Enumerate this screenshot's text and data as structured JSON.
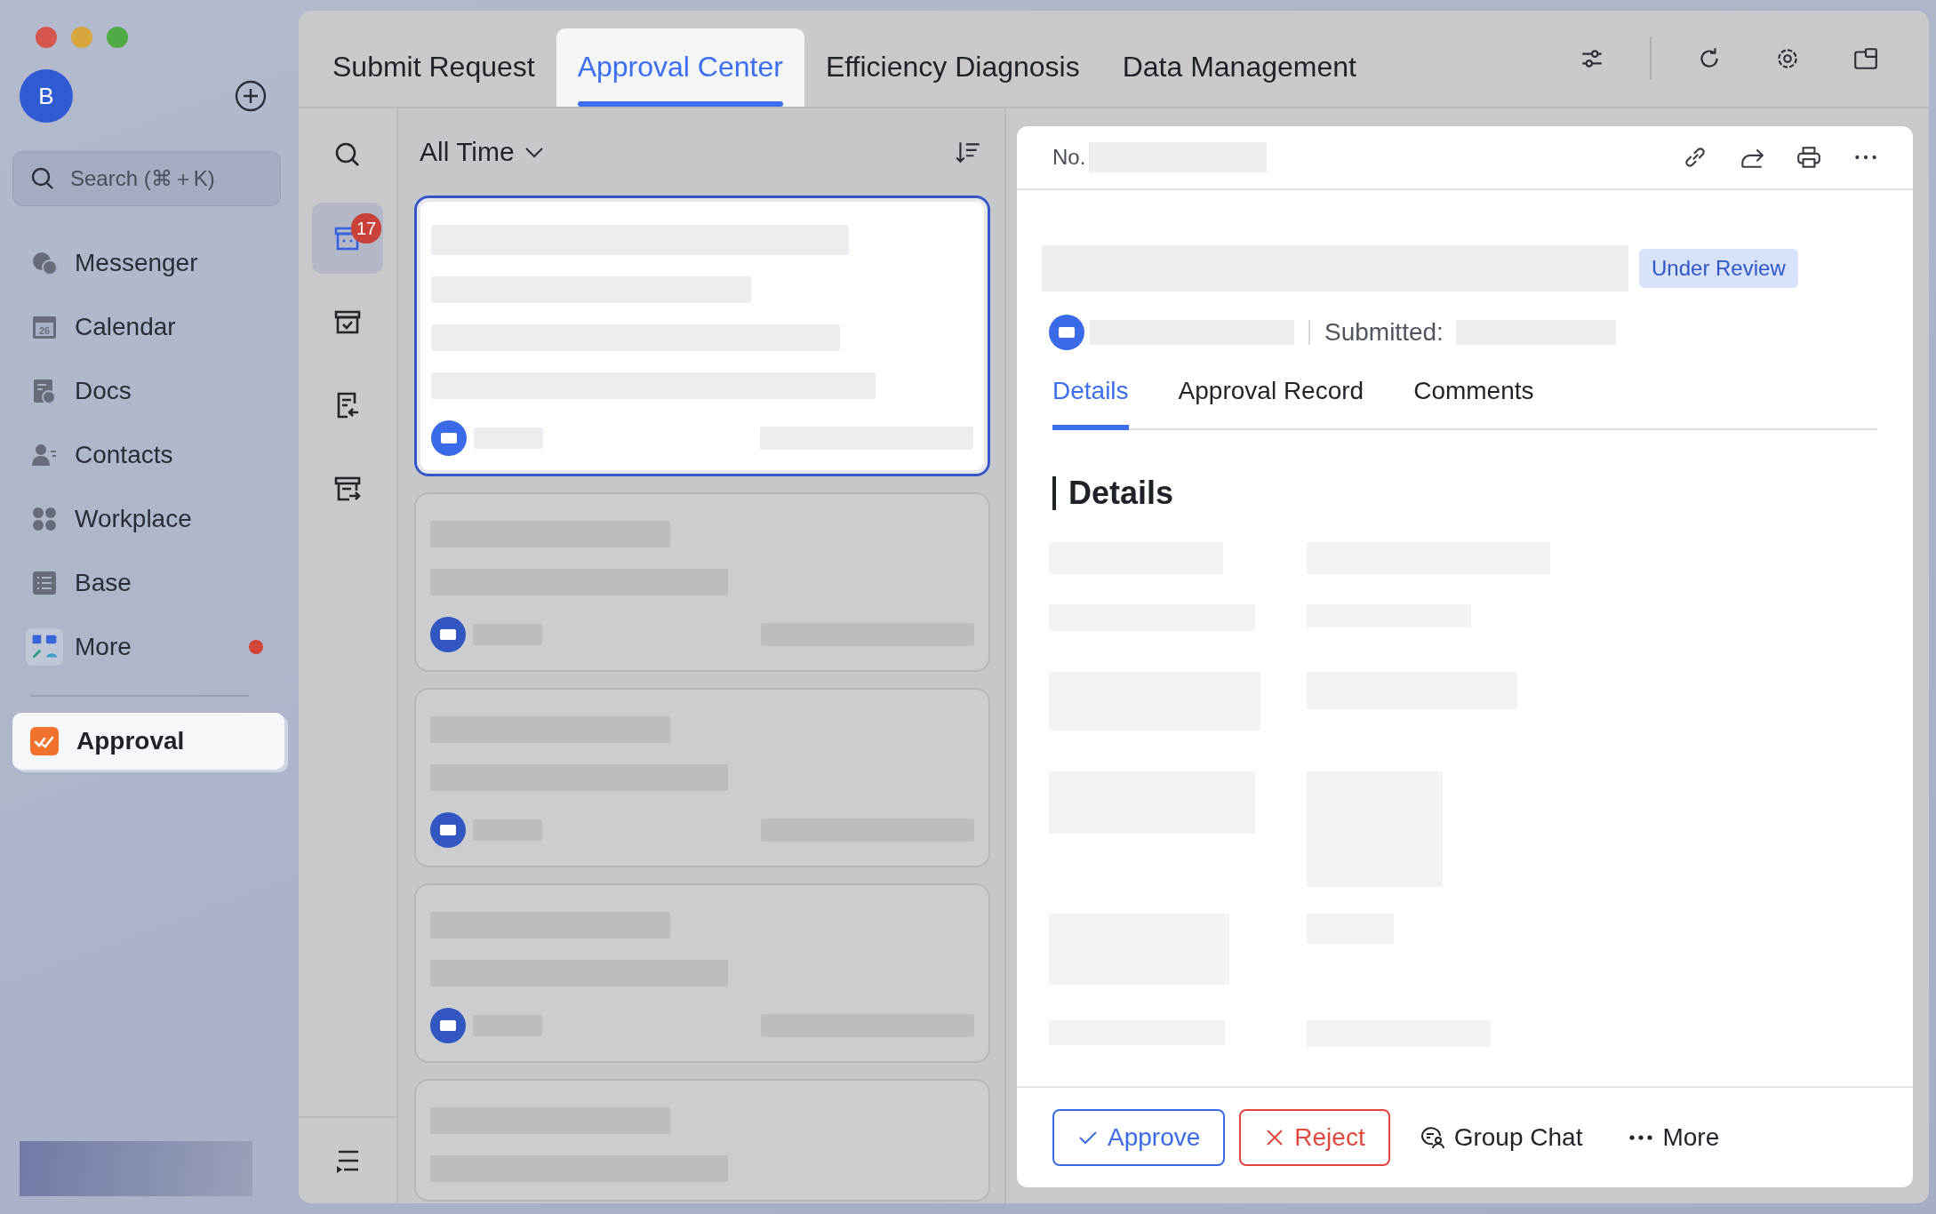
{
  "account": {
    "initial": "B"
  },
  "search": {
    "placeholder": "Search (⌘＋K)"
  },
  "sidebar": {
    "items": [
      {
        "label": "Messenger",
        "unread": false
      },
      {
        "label": "Calendar",
        "icon_label": "26",
        "unread": false
      },
      {
        "label": "Docs",
        "unread": false
      },
      {
        "label": "Contacts",
        "unread": false
      },
      {
        "label": "Workplace",
        "unread": false
      },
      {
        "label": "Base",
        "unread": false
      },
      {
        "label": "More",
        "unread": true
      }
    ],
    "apps": [
      {
        "label": "Approval",
        "selected": true
      }
    ]
  },
  "tabs": [
    {
      "label": "Submit Request",
      "selected": false
    },
    {
      "label": "Approval Center",
      "selected": true
    },
    {
      "label": "Efficiency Diagnosis",
      "selected": false
    },
    {
      "label": "Data Management",
      "selected": false
    }
  ],
  "rail": {
    "items": [
      {
        "selected": false
      },
      {
        "selected": true,
        "badge": "17"
      },
      {
        "selected": false
      },
      {
        "selected": false
      },
      {
        "selected": false
      }
    ]
  },
  "list": {
    "filter": "All Time",
    "cards": [
      {
        "selected": true
      },
      {
        "selected": false
      },
      {
        "selected": false
      },
      {
        "selected": false
      },
      {
        "selected": false
      }
    ]
  },
  "detail": {
    "number_label": "No.",
    "status": "Under Review",
    "submitted_label": "Submitted:",
    "tabs": [
      {
        "label": "Details",
        "selected": true
      },
      {
        "label": "Approval Record",
        "selected": false
      },
      {
        "label": "Comments",
        "selected": false
      }
    ],
    "section_title": "Details",
    "actions": [
      {
        "kind": "approve",
        "label": "Approve"
      },
      {
        "kind": "reject",
        "label": "Reject"
      },
      {
        "kind": "chat",
        "label": "Group Chat"
      },
      {
        "kind": "more",
        "label": "More"
      }
    ]
  }
}
